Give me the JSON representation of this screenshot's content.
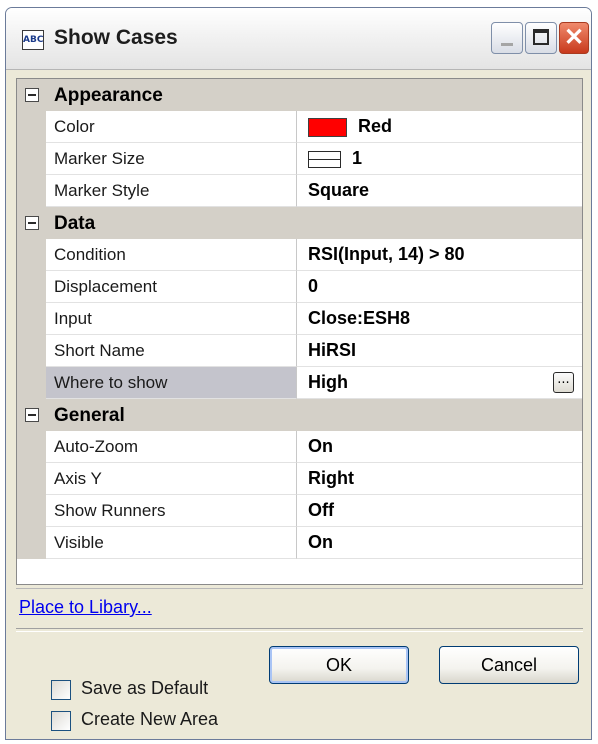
{
  "window": {
    "title": "Show Cases",
    "icon_text": "ABC",
    "minimize_icon": "minimize-icon",
    "maximize_icon": "maximize-icon",
    "close_icon": "close-icon",
    "close_glyph": "✕"
  },
  "properties": {
    "categories": [
      {
        "label": "Appearance",
        "rows": [
          {
            "name": "Color",
            "value": "Red",
            "swatch_color": "#ff0000"
          },
          {
            "name": "Marker Size",
            "value": "1"
          },
          {
            "name": "Marker Style",
            "value": "Square"
          }
        ]
      },
      {
        "label": "Data",
        "rows": [
          {
            "name": "Condition",
            "value": "RSI(Input, 14) > 80"
          },
          {
            "name": "Displacement",
            "value": "0"
          },
          {
            "name": "Input",
            "value": "Close:ESH8"
          },
          {
            "name": "Short Name",
            "value": "HiRSI"
          },
          {
            "name": "Where to show",
            "value": "High",
            "button_label": "..."
          }
        ]
      },
      {
        "label": "General",
        "rows": [
          {
            "name": "Auto-Zoom",
            "value": "On"
          },
          {
            "name": "Axis Y",
            "value": "Right"
          },
          {
            "name": "Show Runners",
            "value": "Off"
          },
          {
            "name": "Visible",
            "value": "On"
          }
        ]
      }
    ]
  },
  "library_link": "Place to Libary...",
  "options": {
    "save_default": {
      "label": "Save as Default",
      "checked": false
    },
    "create_area": {
      "label": "Create New Area",
      "checked": false
    }
  },
  "buttons": {
    "ok": "OK",
    "cancel": "Cancel"
  }
}
